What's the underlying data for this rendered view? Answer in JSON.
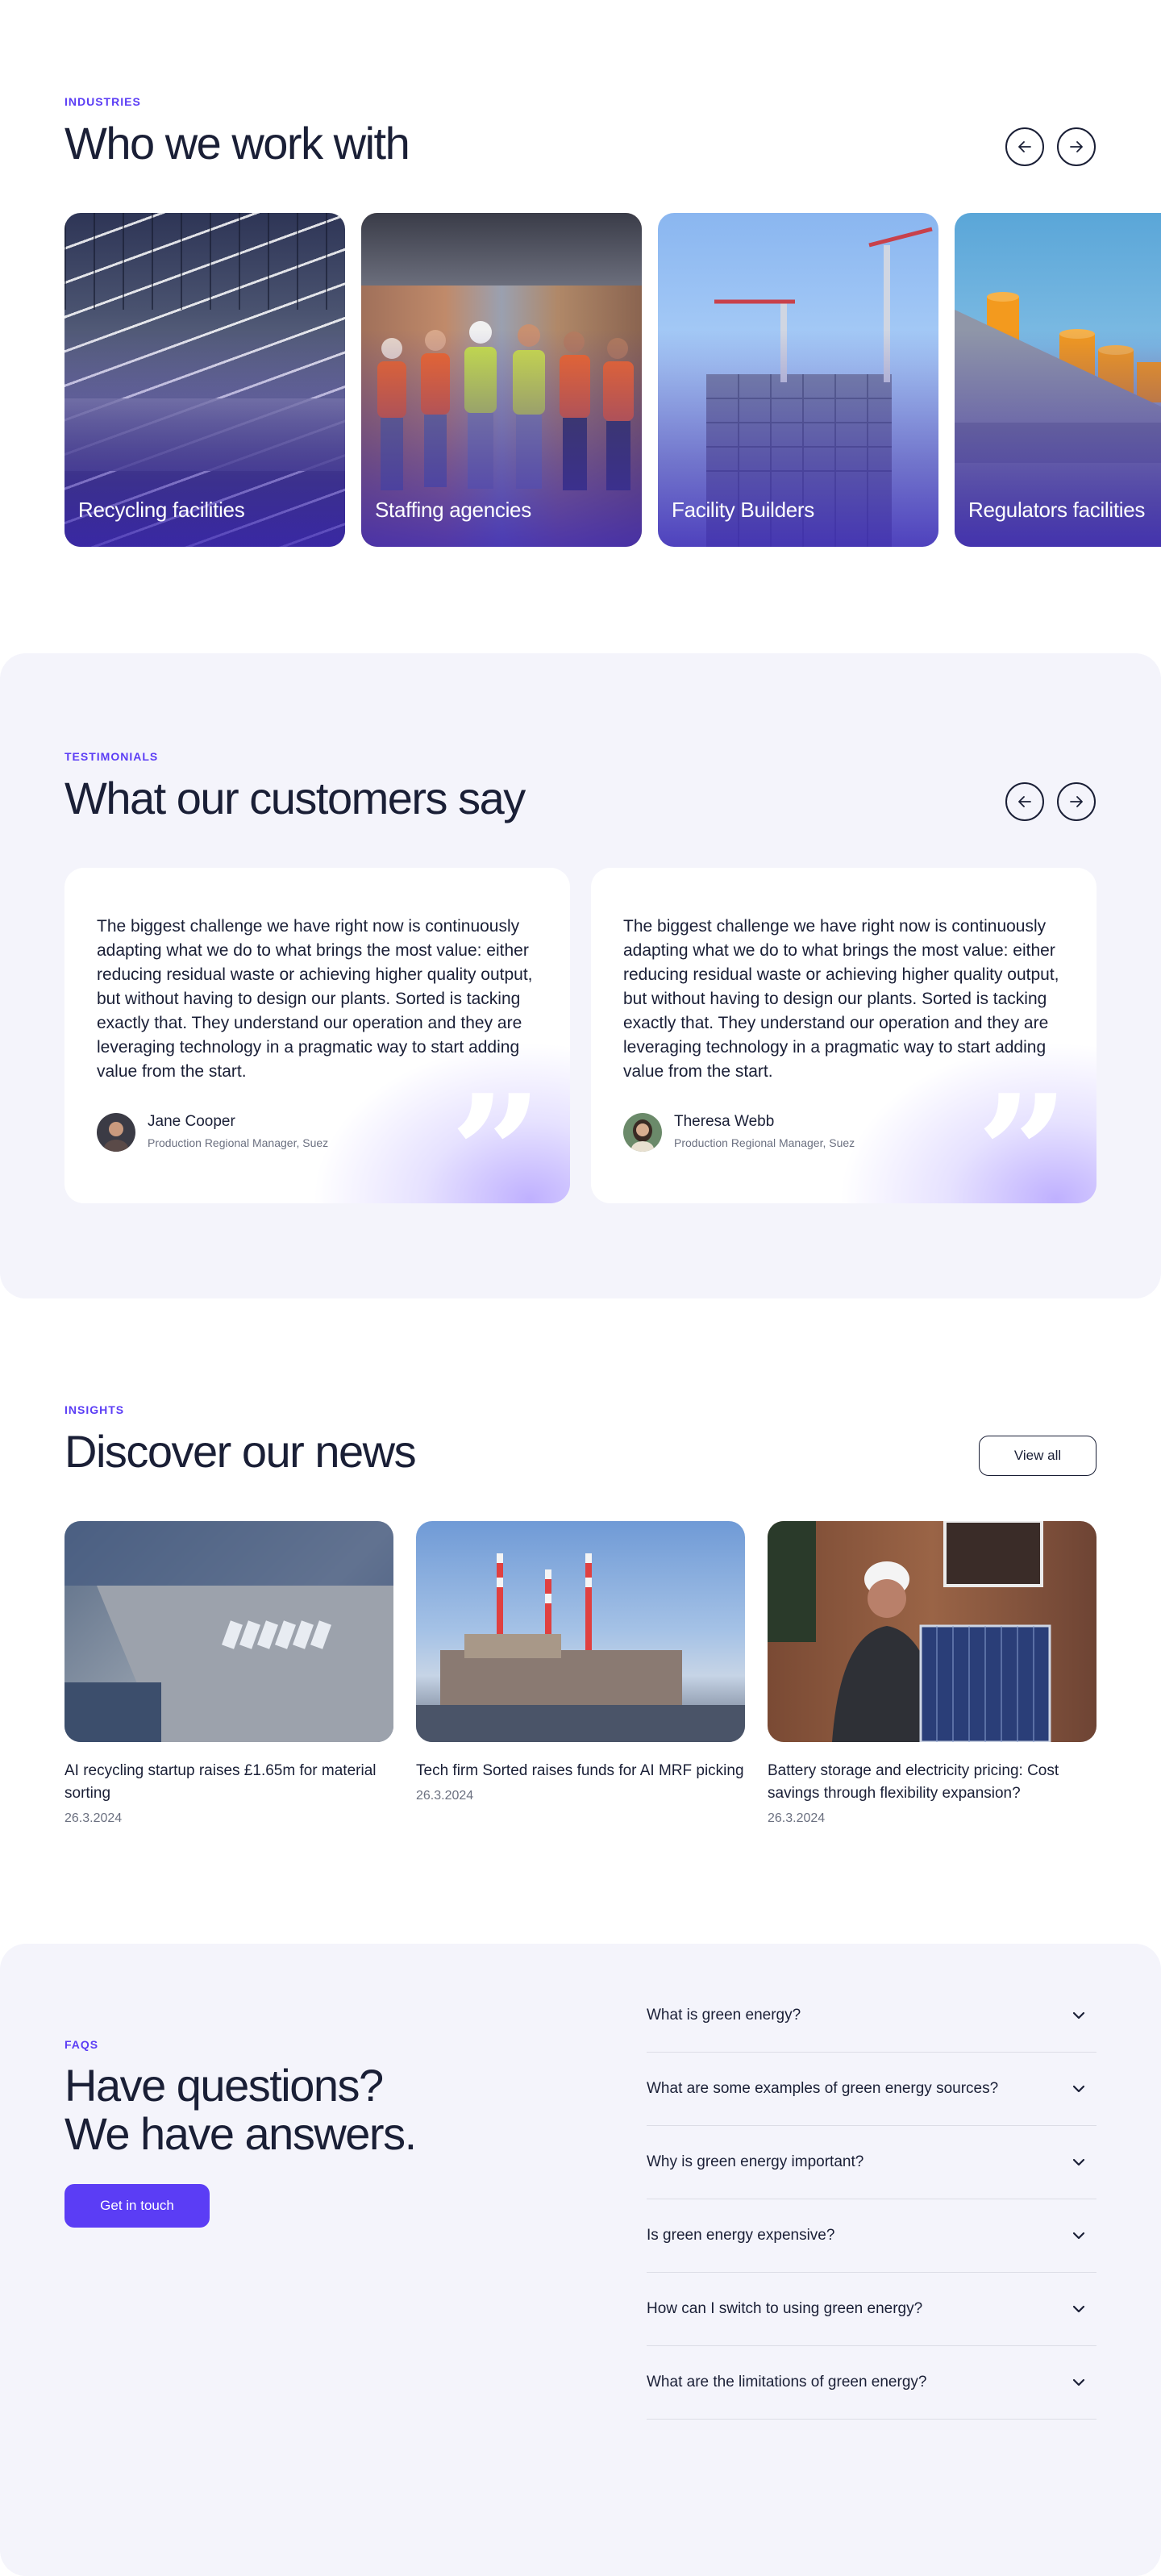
{
  "industries": {
    "eyebrow": "INDUSTRIES",
    "title": "Who we work with",
    "prev_icon": "arrow-left-icon",
    "next_icon": "arrow-right-icon",
    "cards": [
      {
        "label": "Recycling facilities"
      },
      {
        "label": "Staffing agencies"
      },
      {
        "label": "Facility Builders"
      },
      {
        "label": "Regulators facilities"
      }
    ]
  },
  "testimonials": {
    "eyebrow": "TESTIMONIALS",
    "title": "What our customers say",
    "items": [
      {
        "quote": "The biggest challenge we have right now is continuously adapting what we do to what brings the most value: either reducing residual waste or achieving higher quality output, but without having to design our plants. Sorted is tacking exactly that. They understand our operation and they are leveraging technology in a pragmatic way to start adding value from the start.",
        "name": "Jane Cooper",
        "role": "Production Regional Manager, Suez"
      },
      {
        "quote": "The biggest challenge we have right now is continuously adapting what we do to what brings the most value: either reducing residual waste or achieving higher quality output, but without having to design our plants. Sorted is tacking exactly that. They understand our operation and they are leveraging technology in a pragmatic way to start adding value from the start.",
        "name": "Theresa Webb",
        "role": "Production Regional Manager, Suez"
      }
    ]
  },
  "insights": {
    "eyebrow": "INSIGHTS",
    "title": "Discover our news",
    "view_all": "View all",
    "news": [
      {
        "headline": "AI recycling startup raises £1.65m for material sorting",
        "date": "26.3.2024"
      },
      {
        "headline": "Tech firm Sorted raises funds for AI MRF picking",
        "date": "26.3.2024"
      },
      {
        "headline": "Battery storage and electricity pricing: Cost savings through flexibility expansion?",
        "date": "26.3.2024"
      }
    ]
  },
  "faq": {
    "eyebrow": "FAQS",
    "title_line1": "Have questions?",
    "title_line2": "We have answers.",
    "cta": "Get in touch",
    "items": [
      {
        "question": "What is green energy?"
      },
      {
        "question": "What are some examples of green energy sources?"
      },
      {
        "question": "Why is green energy important?"
      },
      {
        "question": "Is green energy expensive?"
      },
      {
        "question": "How can I switch to using green energy?"
      },
      {
        "question": "What are the limitations of green energy?"
      }
    ]
  },
  "colors": {
    "accent": "#5b3df5",
    "text": "#1a1f36",
    "muted": "#6b7080",
    "section_bg": "#f4f4fb"
  }
}
